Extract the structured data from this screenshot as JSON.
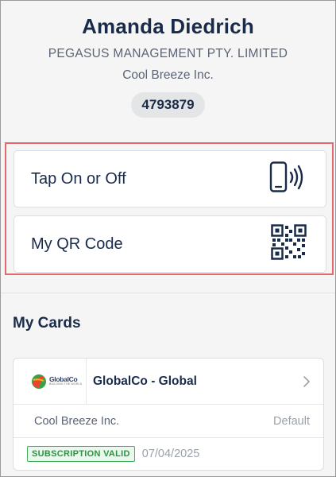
{
  "profile": {
    "name": "Amanda Diedrich",
    "company": "PEGASUS MANAGEMENT PTY. LIMITED",
    "organization": "Cool Breeze Inc.",
    "member_id": "4793879"
  },
  "actions": [
    {
      "label": "Tap On or Off",
      "icon": "phone-tap-icon"
    },
    {
      "label": "My QR Code",
      "icon": "qr-code-icon"
    }
  ],
  "section_title": "My Cards",
  "card": {
    "logo_brand": "GlobalCo",
    "logo_tagline": "BUILDING THE WORLD",
    "title": "GlobalCo - Global",
    "organization": "Cool Breeze Inc.",
    "default_label": "Default",
    "status_badge": "SUBSCRIPTION VALID",
    "expiry": "07/04/2025"
  },
  "colors": {
    "primary_text": "#1a2b4a",
    "highlight_border": "#e06a6e",
    "status_green": "#3fb15a",
    "background": "#f5f5f6"
  }
}
